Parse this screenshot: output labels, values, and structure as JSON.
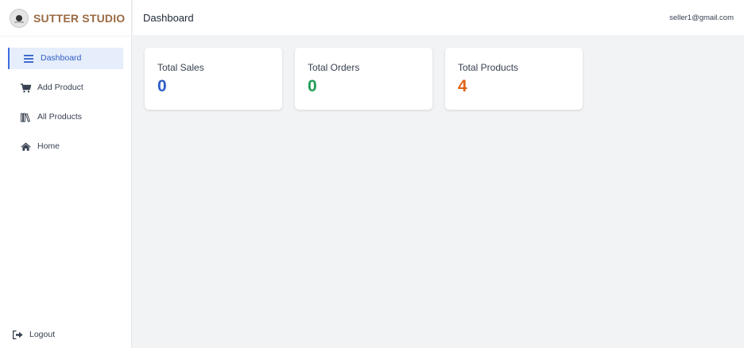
{
  "brand": {
    "name": "SUTTER STUDIO",
    "logo_text": "SUTTER"
  },
  "header": {
    "title": "Dashboard",
    "user_email": "seller1@gmail.com"
  },
  "sidebar": {
    "items": [
      {
        "label": "Dashboard",
        "icon": "menu-icon",
        "active": true
      },
      {
        "label": "Add Product",
        "icon": "cart-icon",
        "active": false
      },
      {
        "label": "All Products",
        "icon": "books-icon",
        "active": false
      },
      {
        "label": "Home",
        "icon": "home-icon",
        "active": false
      }
    ],
    "logout": {
      "label": "Logout",
      "icon": "logout-icon"
    }
  },
  "stats": [
    {
      "title": "Total Sales",
      "value": "0",
      "color": "#2f5fc7"
    },
    {
      "title": "Total Orders",
      "value": "0",
      "color": "#1f9d55"
    },
    {
      "title": "Total Products",
      "value": "4",
      "color": "#e0631b"
    }
  ],
  "colors": {
    "accent": "#3d6ee0",
    "brand": "#9a6a43",
    "active_bg": "#e6edfb"
  }
}
